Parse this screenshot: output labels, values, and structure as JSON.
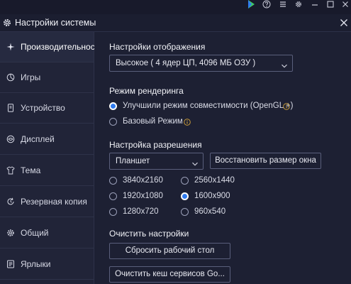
{
  "colors": {
    "accent": "#2f7bf0",
    "info": "#d6a53a",
    "play_green": "#3fca6b"
  },
  "topbar": {
    "icons": [
      "play-store-icon",
      "help-icon",
      "menu-icon",
      "settings-icon",
      "minimize-icon",
      "maximize-icon",
      "close-icon"
    ]
  },
  "window": {
    "title": "Настройки системы"
  },
  "sidebar": {
    "items": [
      {
        "label": "Производительность",
        "icon": "performance-icon",
        "active": true
      },
      {
        "label": "Игры",
        "icon": "games-icon"
      },
      {
        "label": "Устройство",
        "icon": "device-icon"
      },
      {
        "label": "Дисплей",
        "icon": "display-icon"
      },
      {
        "label": "Тема",
        "icon": "theme-icon"
      },
      {
        "label": "Резервная копия",
        "icon": "backup-icon"
      },
      {
        "label": "Общий",
        "icon": "general-icon"
      },
      {
        "label": "Ярлыки",
        "icon": "shortcuts-icon"
      }
    ]
  },
  "display": {
    "title": "Настройки отображения",
    "selected": "Высокое ( 4 ядер ЦП, 4096 МБ ОЗУ )"
  },
  "render": {
    "title": "Режим рендеринга",
    "options": [
      {
        "label": "Улучшили режим совместимости (OpenGL +)",
        "selected": true
      },
      {
        "label": "Базовый Режим",
        "selected": false
      }
    ]
  },
  "resolution": {
    "title": "Настройка разрешения",
    "device_selected": "Планшет",
    "restore_button": "Восстановить размер окна",
    "options": [
      {
        "label": "3840x2160",
        "selected": false
      },
      {
        "label": "2560x1440",
        "selected": false
      },
      {
        "label": "1920x1080",
        "selected": false
      },
      {
        "label": "1600x900",
        "selected": true
      },
      {
        "label": "1280x720",
        "selected": false
      },
      {
        "label": "960x540",
        "selected": false
      }
    ]
  },
  "clear": {
    "title": "Очистить настройки",
    "reset_button": "Сбросить рабочий стол",
    "clear_cache_button": "Очистить кеш сервисов Go..."
  }
}
